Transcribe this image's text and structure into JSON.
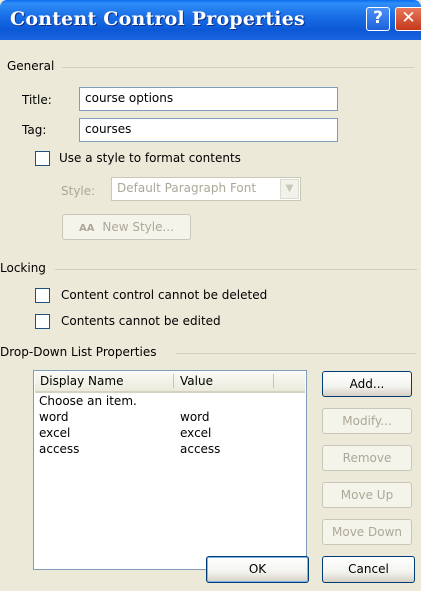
{
  "dialog": {
    "title": "Content Control Properties",
    "help_label": "?",
    "close_label": "✕"
  },
  "general": {
    "heading": "General",
    "title_label": "Title:",
    "title_value": "course options",
    "tag_label": "Tag:",
    "tag_value": "courses",
    "use_style_label": "Use a style to format contents",
    "style_label": "Style:",
    "style_value": "Default Paragraph Font",
    "new_style_label": "New Style...",
    "new_style_icon": "AA"
  },
  "locking": {
    "heading": "Locking",
    "cannot_delete_label": "Content control cannot be deleted",
    "cannot_edit_label": "Contents cannot be edited"
  },
  "dropdown": {
    "heading": "Drop-Down List Properties",
    "columns": [
      "Display Name",
      "Value"
    ],
    "rows": [
      {
        "name": "Choose an item.",
        "value": ""
      },
      {
        "name": "word",
        "value": "word"
      },
      {
        "name": "excel",
        "value": "excel"
      },
      {
        "name": "access",
        "value": "access"
      }
    ],
    "buttons": {
      "add": "Add...",
      "modify": "Modify...",
      "remove": "Remove",
      "move_up": "Move Up",
      "move_down": "Move Down"
    }
  },
  "footer": {
    "ok": "OK",
    "cancel": "Cancel"
  },
  "colors": {
    "titlebar": "#1a6ee6",
    "dialog_face": "#ece9d8",
    "field_border": "#7f9db9",
    "disabled_text": "#aca899"
  }
}
